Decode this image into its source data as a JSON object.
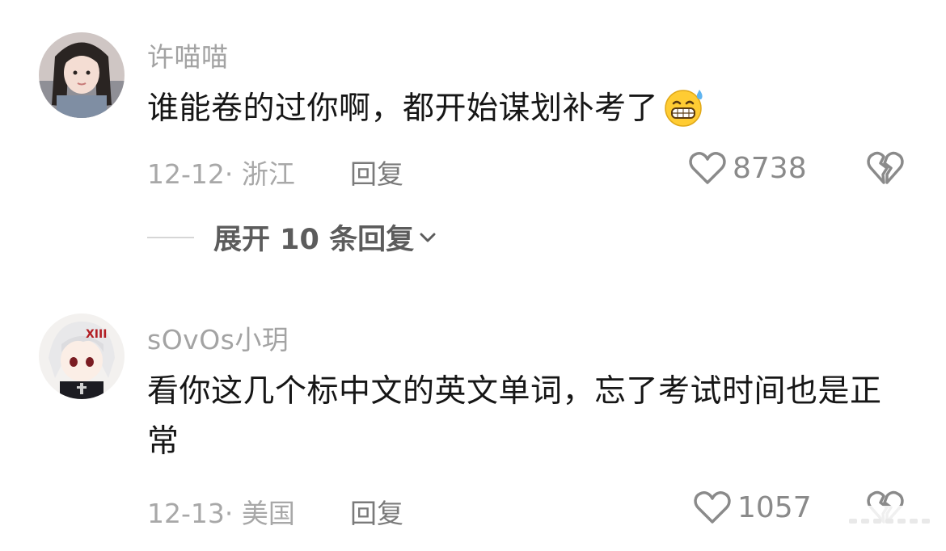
{
  "comments": [
    {
      "username": "许喵喵",
      "text": "谁能卷的过你啊，都开始谋划补考了",
      "emoji": "grinning-sweat-emoji",
      "date_location": "12-12· 浙江",
      "reply_label": "回复",
      "like_count": "8738",
      "expand_label": "展开 10 条回复"
    },
    {
      "username": "sOvOs小玥",
      "text": "看你这几个标中文的英文单词，忘了考试时间也是正常",
      "date_location": "12-13· 美国",
      "reply_label": "回复",
      "like_count": "1057"
    }
  ],
  "icons": {
    "like": "heart-outline-icon",
    "dislike": "broken-heart-icon",
    "expand": "chevron-down-icon"
  },
  "colors": {
    "text": "#161616",
    "muted": "#a3a3a3",
    "reply": "#7a7a7a"
  }
}
